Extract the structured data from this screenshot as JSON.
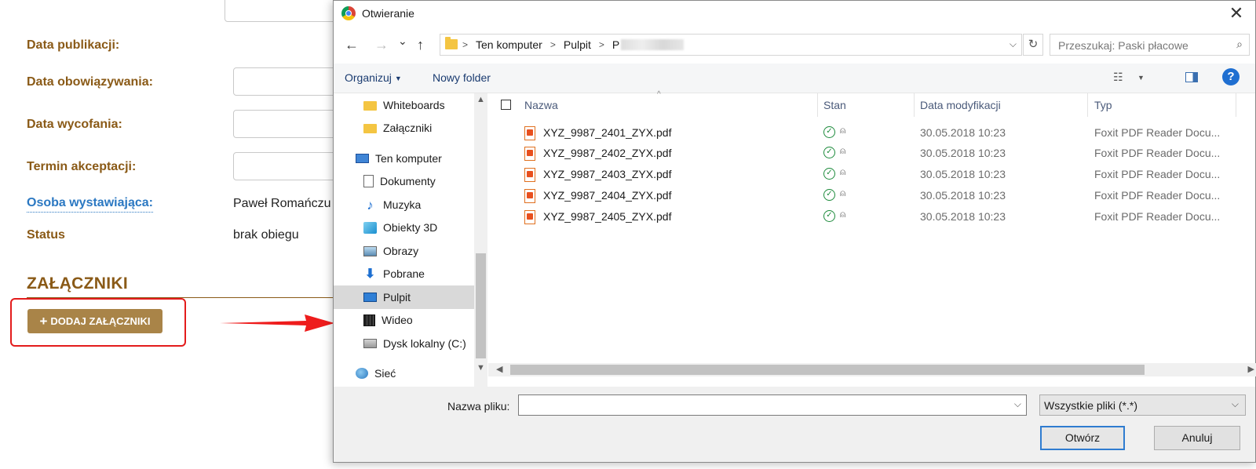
{
  "form": {
    "labels": {
      "publication_date": "Data publikacji:",
      "valid_date": "Data obowiązywania:",
      "withdraw_date": "Data wycofania:",
      "accept_deadline": "Termin akceptacji:",
      "issuer": "Osoba wystawiająca:",
      "status": "Status"
    },
    "values": {
      "issuer": "Paweł Romańczu",
      "status": "brak obiegu"
    },
    "section_title": "ZAŁĄCZNIKI",
    "add_button_label": "DODAJ ZAŁĄCZNIKI",
    "add_button_icon": "+",
    "colors": {
      "accent": "#8a5a17",
      "link": "#2b78c2",
      "button": "#a98448",
      "highlight": "#e31c1c"
    }
  },
  "dialog": {
    "title": "Otwieranie",
    "close_glyph": "✕",
    "nav": {
      "back": "←",
      "forward": "→",
      "recent": "⌄",
      "up": "↑"
    },
    "breadcrumbs": [
      "Ten komputer",
      "Pulpit",
      "P"
    ],
    "refresh_glyph": "↻",
    "search_placeholder": "Przeszukaj: Paski płacowe",
    "search_glyph": "⌕",
    "toolbar": {
      "organize": "Organizuj",
      "new_folder": "Nowy folder",
      "view_glyph": "☷",
      "help_glyph": "?"
    },
    "tree": [
      {
        "label": "Whiteboards",
        "icon": "folder-icon"
      },
      {
        "label": "Załączniki",
        "icon": "folder-icon"
      },
      {
        "label": "Ten komputer",
        "icon": "computer-icon"
      },
      {
        "label": "Dokumenty",
        "icon": "documents-icon"
      },
      {
        "label": "Muzyka",
        "icon": "music-icon"
      },
      {
        "label": "Obiekty 3D",
        "icon": "objects-3d-icon"
      },
      {
        "label": "Obrazy",
        "icon": "pictures-icon"
      },
      {
        "label": "Pobrane",
        "icon": "downloads-icon"
      },
      {
        "label": "Pulpit",
        "icon": "desktop-icon"
      },
      {
        "label": "Wideo",
        "icon": "video-icon"
      },
      {
        "label": "Dysk lokalny (C:)",
        "icon": "disk-icon"
      },
      {
        "label": "Sieć",
        "icon": "network-icon"
      }
    ],
    "selected_tree_item": "Pulpit",
    "columns": {
      "name": "Nazwa",
      "status": "Stan",
      "modified": "Data modyfikacji",
      "type": "Typ"
    },
    "files": [
      {
        "name": "XYZ_9987_2401_ZYX.pdf",
        "modified": "30.05.2018 10:23",
        "type": "Foxit PDF Reader Docu..."
      },
      {
        "name": "XYZ_9987_2402_ZYX.pdf",
        "modified": "30.05.2018 10:23",
        "type": "Foxit PDF Reader Docu..."
      },
      {
        "name": "XYZ_9987_2403_ZYX.pdf",
        "modified": "30.05.2018 10:23",
        "type": "Foxit PDF Reader Docu..."
      },
      {
        "name": "XYZ_9987_2404_ZYX.pdf",
        "modified": "30.05.2018 10:23",
        "type": "Foxit PDF Reader Docu..."
      },
      {
        "name": "XYZ_9987_2405_ZYX.pdf",
        "modified": "30.05.2018 10:23",
        "type": "Foxit PDF Reader Docu..."
      }
    ],
    "filename_label": "Nazwa pliku:",
    "filename_value": "",
    "filter_value": "Wszystkie pliki (*.*)",
    "open_button": "Otwórz",
    "cancel_button": "Anuluj"
  }
}
